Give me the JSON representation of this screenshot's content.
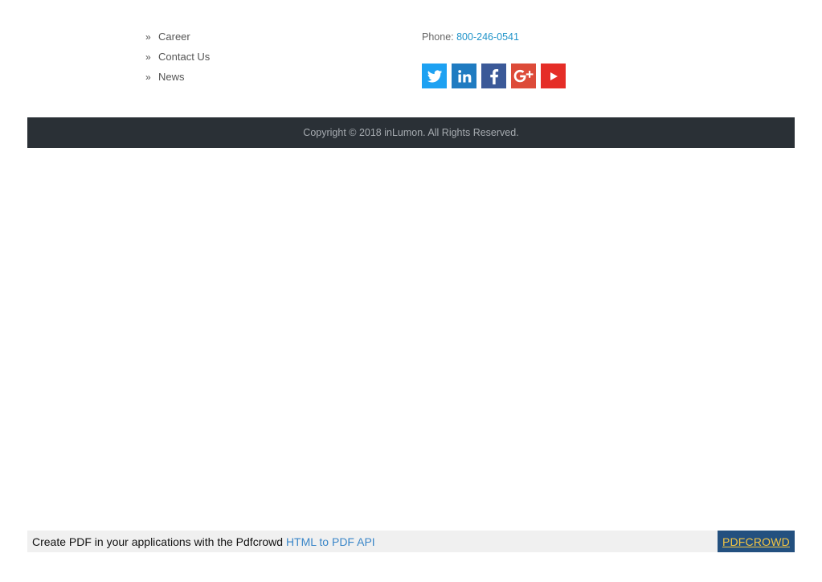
{
  "links": [
    {
      "bullet": "»",
      "label": "Career"
    },
    {
      "bullet": "»",
      "label": "Contact Us"
    },
    {
      "bullet": "»",
      "label": "News"
    }
  ],
  "contact": {
    "phone_label": "Phone: ",
    "phone_value": "800-246-0541"
  },
  "social": [
    {
      "name": "twitter",
      "icon": "twitter-icon",
      "color": "#1da1f2"
    },
    {
      "name": "linkedin",
      "icon": "linkedin-icon",
      "color": "#1f7bc1"
    },
    {
      "name": "facebook",
      "icon": "facebook-icon",
      "color": "#3b5998"
    },
    {
      "name": "google-plus",
      "icon": "google-plus-icon",
      "color": "#dd4b39"
    },
    {
      "name": "youtube",
      "icon": "youtube-icon",
      "color": "#e52d27"
    }
  ],
  "footer": {
    "copyright": "Copyright © 2018 inLumon. All Rights Reserved."
  },
  "pdfbar": {
    "text": "Create PDF in your applications with the Pdfcrowd ",
    "link": "HTML to PDF API",
    "brand": "PDFCROWD"
  }
}
